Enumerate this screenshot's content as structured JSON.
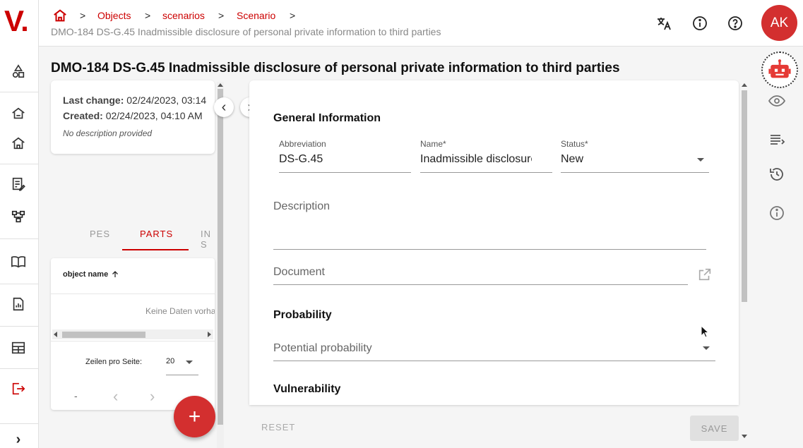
{
  "app": {
    "logo": "V."
  },
  "breadcrumb": {
    "items": [
      "Objects",
      "scenarios",
      "Scenario"
    ],
    "separator": ">",
    "subtitle": "DMO-184 DS-G.45 Inadmissible disclosure of personal private information to third parties"
  },
  "header": {
    "avatar_initials": "AK"
  },
  "page": {
    "title": "DMO-184 DS-G.45 Inadmissible disclosure of personal private information to third parties"
  },
  "info": {
    "last_change_label": "Last change:",
    "last_change_value": "02/24/2023, 03:14",
    "created_label": "Created:",
    "created_value": "02/24/2023, 04:10 AM",
    "description": "No description provided"
  },
  "tabs": {
    "items": [
      "PES",
      "PARTS",
      "IN S"
    ],
    "active": "PARTS"
  },
  "table": {
    "column": "object name",
    "empty_text": "Keine Daten vorhanden",
    "rows_label": "Zeilen pro Seite:",
    "rows_value": "20",
    "pager_range": "-",
    "prev_glyph": "‹",
    "next_glyph": "›"
  },
  "fab": {
    "label": "+"
  },
  "nav": {
    "collapse_left": "‹",
    "expand_right": "›",
    "rail_expand": "›"
  },
  "form": {
    "general_title": "General Information",
    "abbreviation_label": "Abbreviation",
    "abbreviation_value": "DS-G.45",
    "name_label": "Name*",
    "name_value": "Inadmissible disclosure",
    "status_label": "Status*",
    "status_value": "New",
    "description_label": "Description",
    "document_label": "Document",
    "probability_title": "Probability",
    "probability_placeholder": "Potential probability",
    "vulnerability_title": "Vulnerability",
    "reset_label": "RESET",
    "save_label": "SAVE"
  },
  "colors": {
    "accent": "#cc0000",
    "fab": "#d32f2f",
    "avatar": "#d32f2f"
  }
}
